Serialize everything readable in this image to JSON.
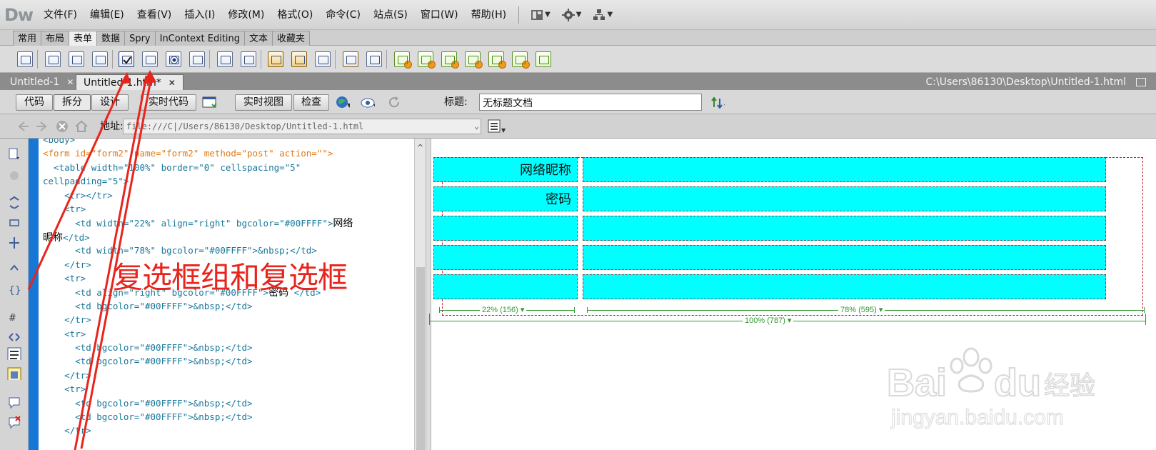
{
  "app": {
    "logo": "Dw"
  },
  "menu": [
    "文件(F)",
    "编辑(E)",
    "查看(V)",
    "插入(I)",
    "修改(M)",
    "格式(O)",
    "命令(C)",
    "站点(S)",
    "窗口(W)",
    "帮助(H)"
  ],
  "menu_tools": [
    {
      "icon": "layout-icon",
      "caret": "▼"
    },
    {
      "icon": "gear-icon",
      "caret": "▼"
    },
    {
      "icon": "site-icon",
      "caret": "▼"
    }
  ],
  "insert_tabs": [
    "常用",
    "布局",
    "表单",
    "数据",
    "Spry",
    "InContext Editing",
    "文本",
    "收藏夹"
  ],
  "insert_active": "表单",
  "doc_tabs": [
    {
      "label": "Untitled-1",
      "close": "✕",
      "active": false
    },
    {
      "label": "Untitled-1.htm*",
      "close": "✕",
      "active": true
    }
  ],
  "file_path": "C:\\Users\\86130\\Desktop\\Untitled-1.html",
  "doc_toolbar": {
    "code": "代码",
    "split": "拆分",
    "design": "设计",
    "live_code": "实时代码",
    "live_view": "实时视图",
    "inspect": "检查",
    "title_label": "标题:",
    "title_value": "无标题文档"
  },
  "address": {
    "label": "地址:",
    "value": "file:///C|/Users/86130/Desktop/Untitled-1.html"
  },
  "code": {
    "lines": [
      {
        "html": "&lt;body&gt;",
        "text": ""
      },
      {
        "html": "<span style=\"color:#e07a15\">&lt;form id=\"form2\" name=\"form2\" method=\"post\" action=\"\"&gt;</span>",
        "text": ""
      },
      {
        "html": "  &lt;table width=\"100%\" border=\"0\" cellspacing=\"5\"",
        "text": ""
      },
      {
        "html": "cellpadding=\"5\"&gt;",
        "text": ""
      },
      {
        "html": "    &lt;tr&gt;&lt;/tr&gt;",
        "text": ""
      },
      {
        "html": "    &lt;tr&gt;",
        "text": ""
      },
      {
        "html": "      &lt;td width=\"22%\" align=\"right\" bgcolor=\"#00FFFF\"&gt;",
        "text": "网络"
      },
      {
        "html": "",
        "text": "昵称",
        "after": "&lt;/td&gt;"
      },
      {
        "html": "      &lt;td width=\"78%\" bgcolor=\"#00FFFF\"&gt;&amp;nbsp;&lt;/td&gt;",
        "text": ""
      },
      {
        "html": "    &lt;/tr&gt;",
        "text": ""
      },
      {
        "html": "    &lt;tr&gt;",
        "text": ""
      },
      {
        "html": "      &lt;td align=\"right\" bgcolor=\"#00FFFF\"&gt;",
        "text": "密码",
        "after": " &lt;/td&gt;"
      },
      {
        "html": "      &lt;td bgcolor=\"#00FFFF\"&gt;&amp;nbsp;&lt;/td&gt;",
        "text": ""
      },
      {
        "html": "    &lt;/tr&gt;",
        "text": ""
      },
      {
        "html": "    &lt;tr&gt;",
        "text": ""
      },
      {
        "html": "      &lt;td bgcolor=\"#00FFFF\"&gt;&amp;nbsp;&lt;/td&gt;",
        "text": ""
      },
      {
        "html": "      &lt;td bgcolor=\"#00FFFF\"&gt;&amp;nbsp;&lt;/td&gt;",
        "text": ""
      },
      {
        "html": "    &lt;/tr&gt;",
        "text": ""
      },
      {
        "html": "    &lt;tr&gt;",
        "text": ""
      },
      {
        "html": "      &lt;td bgcolor=\"#00FFFF\"&gt;&amp;nbsp;&lt;/td&gt;",
        "text": ""
      },
      {
        "html": "      &lt;td bgcolor=\"#00FFFF\"&gt;&amp;nbsp;&lt;/td&gt;",
        "text": ""
      },
      {
        "html": "    &lt;/tr&gt;",
        "text": ""
      }
    ]
  },
  "design": {
    "rows": [
      {
        "label": "网络昵称"
      },
      {
        "label": "密码"
      },
      {
        "label": ""
      },
      {
        "label": ""
      },
      {
        "label": ""
      }
    ],
    "measure_left": "22% (156)",
    "measure_right": "78% (595)",
    "measure_total": "100% (787)",
    "cell_color": "#00FFFF"
  },
  "annotation": {
    "text": "复选框组和复选框"
  },
  "watermark": {
    "brand": "Bai du 经验",
    "url": "jingyan.baidu.com"
  },
  "colors": {
    "gutter": "#1877d4",
    "arrow": "#e8241c",
    "form_border": "#c41b3a",
    "measure": "#2e9a2e"
  }
}
